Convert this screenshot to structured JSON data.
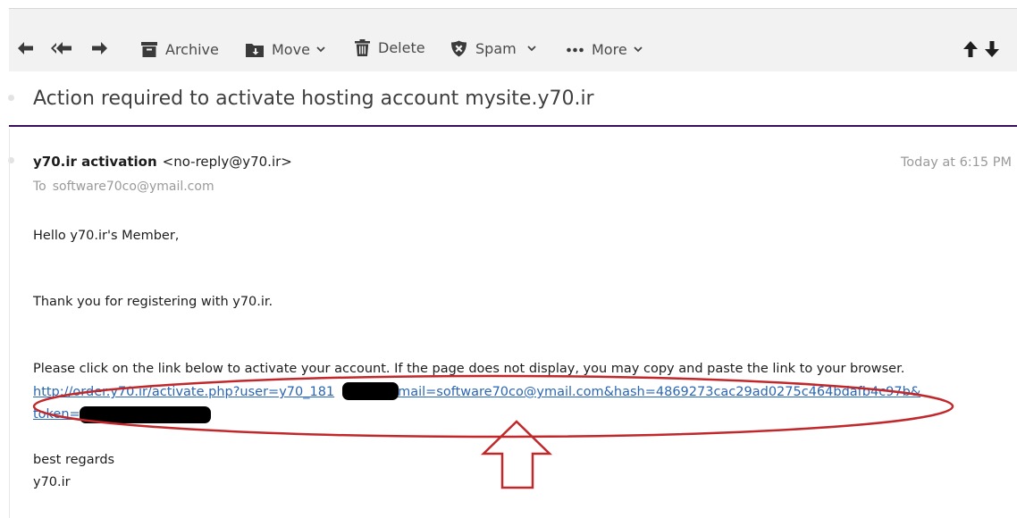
{
  "toolbar": {
    "archive_label": "Archive",
    "move_label": "Move",
    "delete_label": "Delete",
    "spam_label": "Spam",
    "more_label": "More",
    "icons": [
      "reply-icon",
      "reply-all-icon",
      "forward-icon",
      "archive-icon",
      "move-icon",
      "delete-icon",
      "spam-icon",
      "more-icon",
      "chevron-down-icon",
      "arrow-up-icon",
      "arrow-down-icon"
    ]
  },
  "message": {
    "subject": "Action required to activate hosting account mysite.y70.ir",
    "from_name": "y70.ir activation",
    "from_email": "<no-reply@y70.ir>",
    "to_label": "To",
    "to_address": "software70co@ymail.com",
    "date": "Today at 6:15 PM",
    "greeting": "Hello y70.ir's Member,",
    "thanks": "Thank you for registering with y70.ir.",
    "instructions": "Please click on the link below to activate your account. If the page does not display, you may copy and paste the link to your browser.",
    "link_part1": "http://order.y70.ir/activate.php?user=y70_181",
    "link_part2": "email=software70co@ymail.com&hash=4869273cac29ad0275c464bdafb4c97b&",
    "link_part3": "token=",
    "closing": "best regards",
    "signature": "y70.ir"
  },
  "colors": {
    "toolbar_bg": "#f2f2f3",
    "subject_rule": "#3a0e5a",
    "link": "#2a66b4",
    "annotation": "#c0282b"
  }
}
